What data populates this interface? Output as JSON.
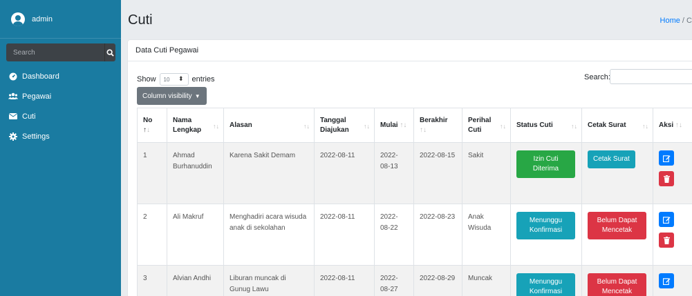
{
  "sidebar": {
    "user": "admin",
    "search_placeholder": "Search",
    "items": [
      {
        "label": "Dashboard",
        "icon": "dashboard-icon"
      },
      {
        "label": "Pegawai",
        "icon": "users-icon"
      },
      {
        "label": "Cuti",
        "icon": "envelope-icon"
      },
      {
        "label": "Settings",
        "icon": "gear-icon"
      }
    ]
  },
  "page": {
    "title": "Cuti",
    "breadcrumb_home": "Home",
    "breadcrumb_sep": "/",
    "breadcrumb_current": "C"
  },
  "card": {
    "title": "Data Cuti Pegawai",
    "show_label": "Show",
    "entries_value": "10",
    "entries_label": "entries",
    "search_label": "Search:",
    "colvis_label": "Column visibility"
  },
  "table": {
    "headers": [
      "No",
      "Nama Lengkap",
      "Alasan",
      "Tanggal Diajukan",
      "Mulai",
      "Berakhir",
      "Perihal Cuti",
      "Status Cuti",
      "Cetak Surat",
      "Aksi"
    ],
    "rows": [
      {
        "no": "1",
        "nama": "Ahmad Burhanuddin",
        "alasan": "Karena Sakit Demam",
        "tanggal": "2022-08-11",
        "mulai": "2022-08-13",
        "berakhir": "2022-08-15",
        "perihal": "Sakit",
        "status": "Izin Cuti Diterima",
        "cetak": "Cetak Surat"
      },
      {
        "no": "2",
        "nama": "Ali Makruf",
        "alasan": "Menghadiri acara wisuda anak di sekolahan",
        "tanggal": "2022-08-11",
        "mulai": "2022-08-22",
        "berakhir": "2022-08-23",
        "perihal": "Anak Wisuda",
        "status": "Menunggu Konfirmasi",
        "cetak": "Belum Dapat Mencetak"
      },
      {
        "no": "3",
        "nama": "Alvian Andhi",
        "alasan": "Liburan muncak di Gunug Lawu",
        "tanggal": "2022-08-11",
        "mulai": "2022-08-27",
        "berakhir": "2022-08-29",
        "perihal": "Muncak",
        "status": "Menunggu Konfirmasi",
        "cetak": "Belum Dapat Mencetak"
      }
    ]
  },
  "colors": {
    "sidebar": "#1a7ba1",
    "green": "#28a745",
    "teal": "#17a2b8",
    "red": "#dc3545",
    "blue": "#007bff"
  }
}
